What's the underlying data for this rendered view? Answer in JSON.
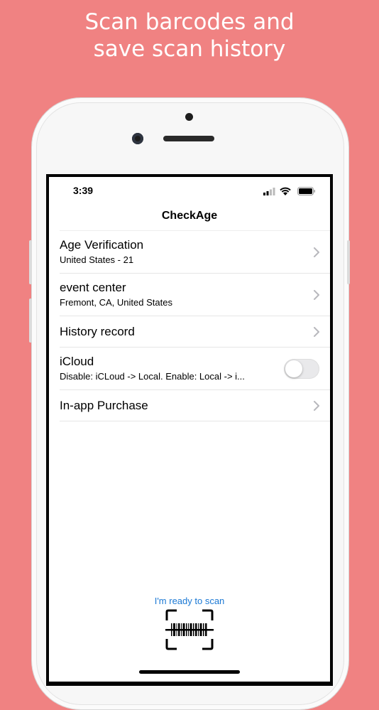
{
  "promo": {
    "line1": "Scan barcodes and",
    "line2": "save scan history"
  },
  "status_bar": {
    "time": "3:39"
  },
  "nav": {
    "title": "CheckAge"
  },
  "settings": [
    {
      "title": "Age Verification",
      "subtitle": "United States - 21",
      "accessory": "chevron-right-icon"
    },
    {
      "title": "event center",
      "subtitle": "Fremont, CA, United States",
      "accessory": "chevron-right-icon"
    },
    {
      "title": "History record",
      "accessory": "chevron-right-icon"
    },
    {
      "title": "iCloud",
      "subtitle": "Disable: iCLoud -> Local.   Enable: Local -> i...",
      "accessory": "toggle",
      "toggle_on": false
    },
    {
      "title": "In-app Purchase",
      "accessory": "chevron-right-icon"
    }
  ],
  "scan": {
    "label": "I'm ready to scan",
    "icon": "barcode-scan-icon"
  },
  "colors": {
    "background": "#f08282",
    "link": "#1a78d4",
    "toggle_off": "#e9e9eb"
  }
}
